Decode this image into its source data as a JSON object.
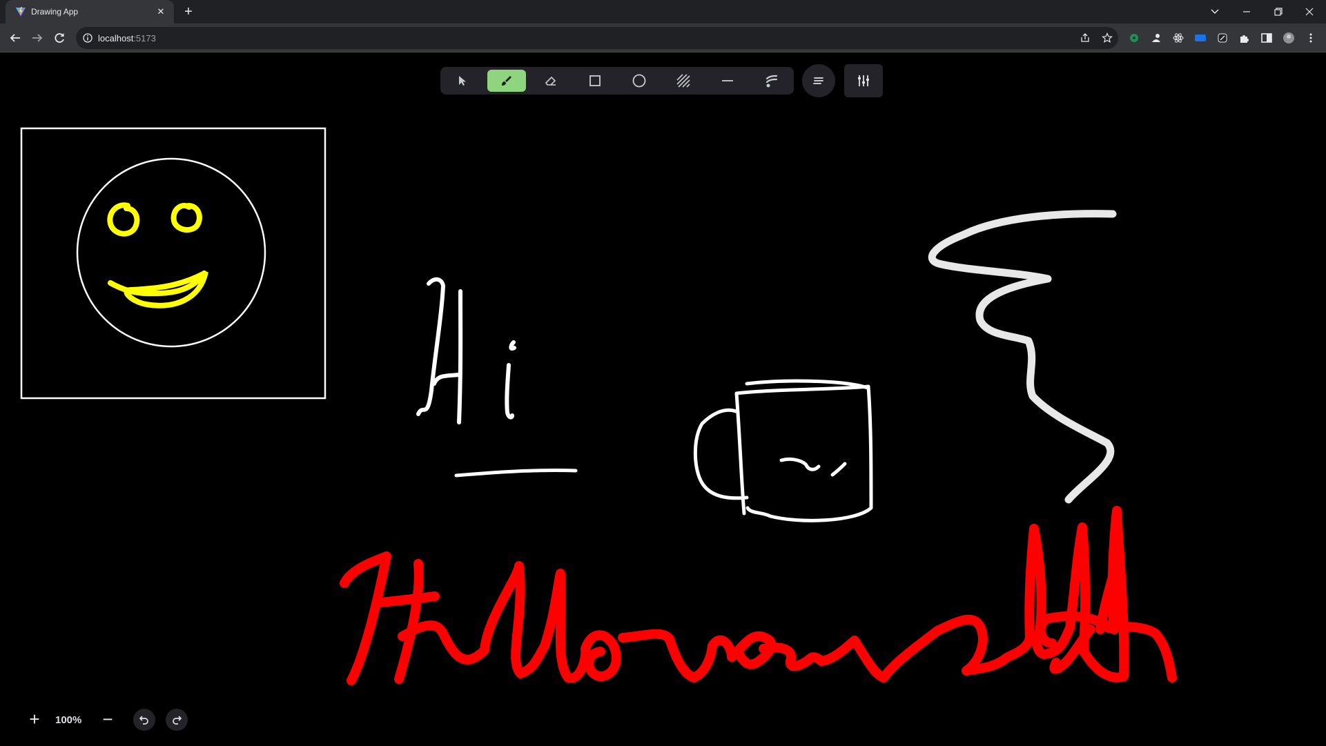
{
  "browser": {
    "tab_title": "Drawing App",
    "url_host": "localhost",
    "url_port": ":5173"
  },
  "tools": [
    {
      "name": "select",
      "icon": "cursor-icon",
      "active": false
    },
    {
      "name": "brush",
      "icon": "brush-icon",
      "active": true
    },
    {
      "name": "eraser",
      "icon": "eraser-icon",
      "active": false
    },
    {
      "name": "rectangle",
      "icon": "square-icon",
      "active": false
    },
    {
      "name": "ellipse",
      "icon": "circle-icon",
      "active": false
    },
    {
      "name": "fill",
      "icon": "hatch-icon",
      "active": false
    },
    {
      "name": "line",
      "icon": "line-icon",
      "active": false
    },
    {
      "name": "stroke",
      "icon": "stroke-icon",
      "active": false
    }
  ],
  "zoom": {
    "label": "100%",
    "level": 100
  },
  "colors": {
    "canvas_bg": "#000000",
    "active_tool": "#8fd47f",
    "panel": "#232329",
    "stroke_white": "#ffffff",
    "stroke_yellow": "#ffff00",
    "stroke_red": "#ff0000"
  }
}
